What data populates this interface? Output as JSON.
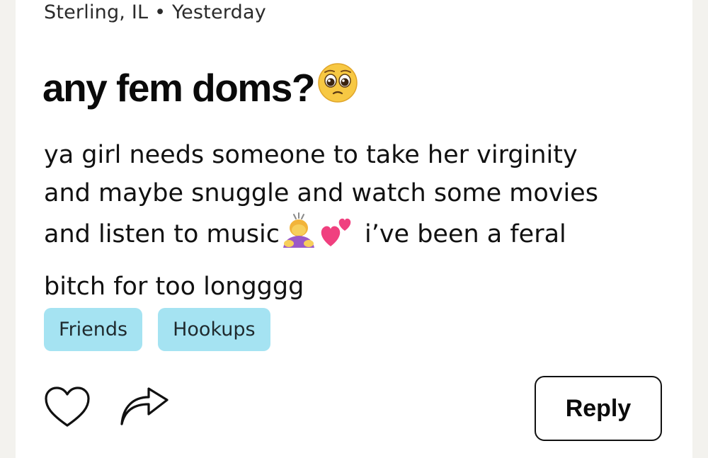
{
  "post": {
    "location": "Sterling, IL",
    "separator": "•",
    "time": "Yesterday",
    "title": "any fem doms?",
    "title_emoji": "pleading-face",
    "body_lines": [
      "ya girl needs someone to take her virginity",
      "and maybe snuggle and watch some movies",
      "and listen to music",
      "i’ve been a feral",
      "bitch for too longggg"
    ],
    "inline_emojis": [
      "person-bowing-icon",
      "two-hearts-icon"
    ]
  },
  "tags": [
    "Friends",
    "Hookups"
  ],
  "actions": {
    "like_icon": "heart-icon",
    "share_icon": "share-arrow-icon",
    "reply_label": "Reply"
  },
  "colors": {
    "tag_bg": "#a5e3f2",
    "page_bg": "#f3f2ee",
    "card_bg": "#ffffff"
  }
}
